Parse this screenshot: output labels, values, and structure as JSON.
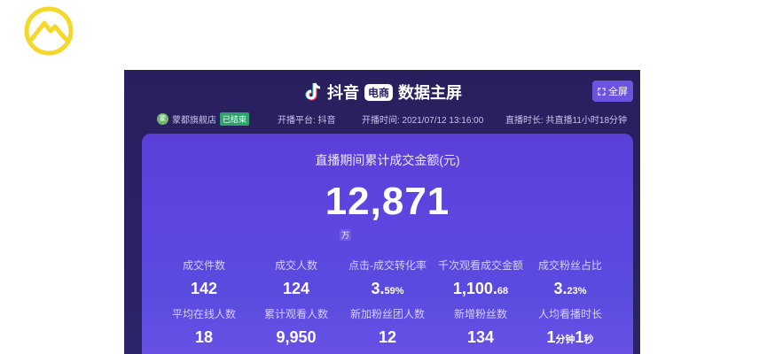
{
  "logo": {
    "icon": "mountain-logo-icon",
    "color": "#f4d82a"
  },
  "header": {
    "app_name": "抖音",
    "badge": "电商",
    "title": "数据主屏",
    "fullscreen_label": "全屏"
  },
  "info": {
    "store_name": "蒙都旗舰店",
    "status": "已结束",
    "platform": "开播平台: 抖音",
    "start_time": "开播时间: 2021/07/12 13:16:00",
    "duration": "直播时长: 共直播11小时18分钟"
  },
  "summary": {
    "title": "直播期间累计成交金额(元)",
    "value": "12,871",
    "unit": "万"
  },
  "stats": [
    {
      "label": "成交件数",
      "value": "142",
      "suffix": ""
    },
    {
      "label": "成交人数",
      "value": "124",
      "suffix": ""
    },
    {
      "label": "点击-成交转化率",
      "value": "3.",
      "suffix": "59%"
    },
    {
      "label": "千次观看成交金额",
      "value": "1,100.",
      "suffix": "68"
    },
    {
      "label": "成交粉丝占比",
      "value": "3.",
      "suffix": "23%"
    },
    {
      "label": "平均在线人数",
      "value": "18",
      "suffix": ""
    },
    {
      "label": "累计观看人数",
      "value": "9,950",
      "suffix": ""
    },
    {
      "label": "新加粉丝团人数",
      "value": "12",
      "suffix": ""
    },
    {
      "label": "新增粉丝数",
      "value": "134",
      "suffix": ""
    },
    {
      "label": "人均看播时长",
      "value_parts": [
        "1",
        "分钟",
        "1",
        "秒"
      ]
    }
  ],
  "colors": {
    "background": "#2a1f5e",
    "panel": "#5b3fd8",
    "ended_badge": "#2fa16c",
    "fullscreen_button": "#6c54e0"
  }
}
